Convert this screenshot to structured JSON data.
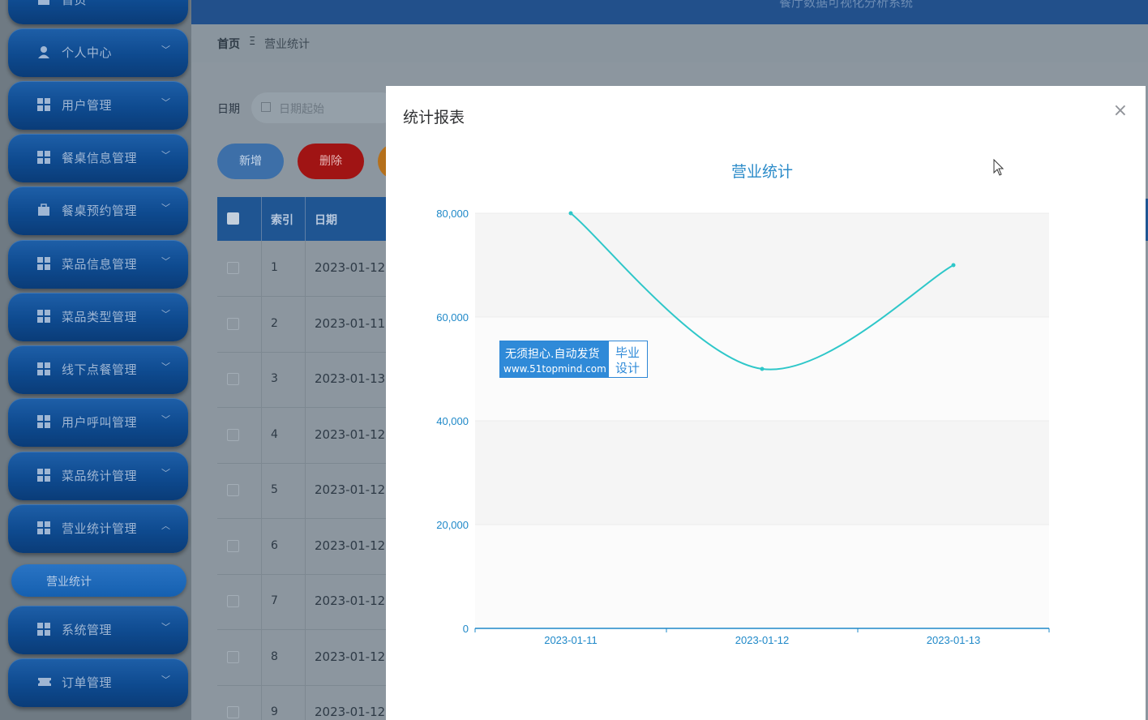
{
  "header": {
    "system_title": "餐厅数据可视化分析系统"
  },
  "sidebar": {
    "items": [
      {
        "label": "首页",
        "icon": "home-icon"
      },
      {
        "label": "个人中心",
        "icon": "user-icon"
      },
      {
        "label": "用户管理",
        "icon": "grid-icon"
      },
      {
        "label": "餐桌信息管理",
        "icon": "grid-icon"
      },
      {
        "label": "餐桌预约管理",
        "icon": "briefcase-icon"
      },
      {
        "label": "菜品信息管理",
        "icon": "grid-icon"
      },
      {
        "label": "菜品类型管理",
        "icon": "grid-icon"
      },
      {
        "label": "线下点餐管理",
        "icon": "grid-icon"
      },
      {
        "label": "用户呼叫管理",
        "icon": "grid-icon"
      },
      {
        "label": "菜品统计管理",
        "icon": "grid-icon"
      },
      {
        "label": "营业统计管理",
        "icon": "grid-icon"
      },
      {
        "label": "系统管理",
        "icon": "grid-icon"
      },
      {
        "label": "订单管理",
        "icon": "ticket-icon"
      }
    ],
    "sub_item": "营业统计"
  },
  "breadcrumb": {
    "home": "首页",
    "separator": "Ξ",
    "current": "营业统计"
  },
  "filter": {
    "label": "日期",
    "placeholder": "日期起始"
  },
  "toolbar": {
    "add_label": "新增",
    "delete_label": "删除"
  },
  "table": {
    "headers": [
      "索引",
      "日期"
    ],
    "rows": [
      {
        "index": "1",
        "date": "2023-01-12"
      },
      {
        "index": "2",
        "date": "2023-01-11"
      },
      {
        "index": "3",
        "date": "2023-01-13"
      },
      {
        "index": "4",
        "date": "2023-01-12"
      },
      {
        "index": "5",
        "date": "2023-01-12"
      },
      {
        "index": "6",
        "date": "2023-01-12"
      },
      {
        "index": "7",
        "date": "2023-01-12"
      },
      {
        "index": "8",
        "date": "2023-01-12"
      },
      {
        "index": "9",
        "date": "2023-01-12"
      }
    ]
  },
  "modal": {
    "title": "统计报表",
    "close_symbol": "×"
  },
  "watermark": {
    "line1": "无须担心.自动发货",
    "line2": "www.51topmind.com",
    "right1": "毕业",
    "right2": "设计"
  },
  "colors": {
    "line": "#2ec7c9",
    "axis_text": "#1e88c8",
    "title": "#2b8bc9"
  },
  "chart_data": {
    "type": "line",
    "title": "营业统计",
    "categories": [
      "2023-01-11",
      "2023-01-12",
      "2023-01-13"
    ],
    "series": [
      {
        "values": [
          80000,
          50000,
          70000
        ]
      }
    ],
    "y_ticks": [
      "0",
      "20,000",
      "40,000",
      "60,000",
      "80,000"
    ],
    "ylim": [
      0,
      80000
    ],
    "smooth": true,
    "grid": true
  }
}
